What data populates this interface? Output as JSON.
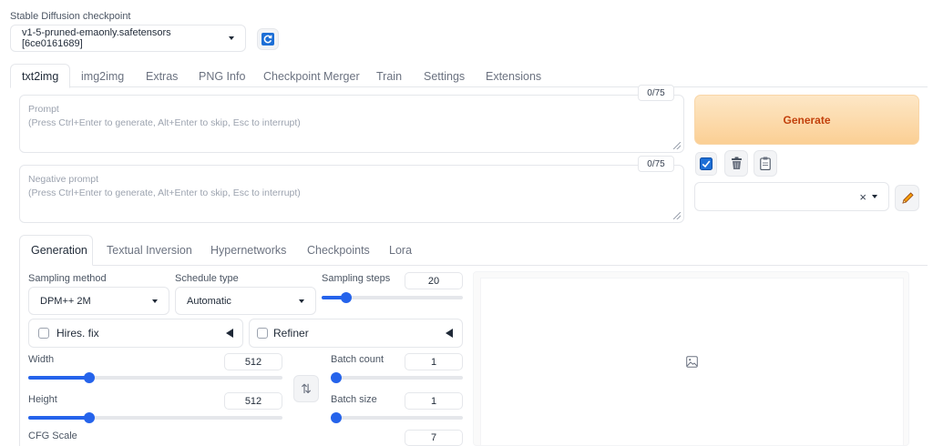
{
  "checkpoint": {
    "label": "Stable Diffusion checkpoint",
    "value": "v1-5-pruned-emaonly.safetensors [6ce0161689]"
  },
  "main_tabs": [
    "txt2img",
    "img2img",
    "Extras",
    "PNG Info",
    "Checkpoint Merger",
    "Train",
    "Settings",
    "Extensions"
  ],
  "prompt": {
    "label": "Prompt",
    "hint": "(Press Ctrl+Enter to generate, Alt+Enter to skip, Esc to interrupt)",
    "counter": "0/75"
  },
  "negative_prompt": {
    "label": "Negative prompt",
    "hint": "(Press Ctrl+Enter to generate, Alt+Enter to skip, Esc to interrupt)",
    "counter": "0/75"
  },
  "generate_label": "Generate",
  "styles_clear": "×",
  "sub_tabs": [
    "Generation",
    "Textual Inversion",
    "Hypernetworks",
    "Checkpoints",
    "Lora"
  ],
  "sampling_method": {
    "label": "Sampling method",
    "value": "DPM++ 2M"
  },
  "schedule_type": {
    "label": "Schedule type",
    "value": "Automatic"
  },
  "sampling_steps": {
    "label": "Sampling steps",
    "value": "20",
    "fraction": 0.15
  },
  "hires_fix": {
    "label": "Hires. fix"
  },
  "refiner": {
    "label": "Refiner"
  },
  "width": {
    "label": "Width",
    "value": "512",
    "fraction": 0.23
  },
  "height": {
    "label": "Height",
    "value": "512",
    "fraction": 0.23
  },
  "batch_count": {
    "label": "Batch count",
    "value": "1",
    "fraction": 0.0
  },
  "batch_size": {
    "label": "Batch size",
    "value": "1",
    "fraction": 0.0
  },
  "cfg_scale": {
    "label": "CFG Scale",
    "value": "7"
  },
  "swap_icon": "⇅",
  "colors": {
    "accent": "#2563eb",
    "generate_from": "#fde7c6",
    "generate_to": "#fbcf94",
    "generate_text": "#c2410c"
  }
}
